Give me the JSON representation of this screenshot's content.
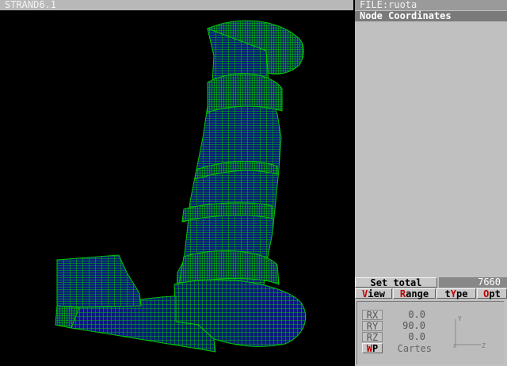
{
  "window": {
    "title": "STRAND6.1"
  },
  "panel": {
    "file_label": "FILE:ruota",
    "header": "Node Coordinates",
    "set_button": "Set total",
    "set_count": "7660",
    "menu": [
      {
        "hot": "V",
        "rest": "iew"
      },
      {
        "hot": "R",
        "rest": "ange"
      },
      {
        "pre": "t",
        "hot": "Y",
        "rest": "pe"
      },
      {
        "hot": "O",
        "rest": "pt"
      }
    ],
    "rotations": [
      {
        "label": "RX",
        "value": "0.0"
      },
      {
        "label": "RY",
        "value": "90.0"
      },
      {
        "label": "RZ",
        "value": "0.0"
      }
    ],
    "wp_button": {
      "hot": "W",
      "rest": "P"
    },
    "wp_value": "Cartes",
    "triad": {
      "y": "Y",
      "x": "X",
      "z": "Z"
    }
  },
  "colors": {
    "mesh_stroke": "#00c800",
    "mesh_fill": "#0a1a7a",
    "background": "#000000"
  }
}
